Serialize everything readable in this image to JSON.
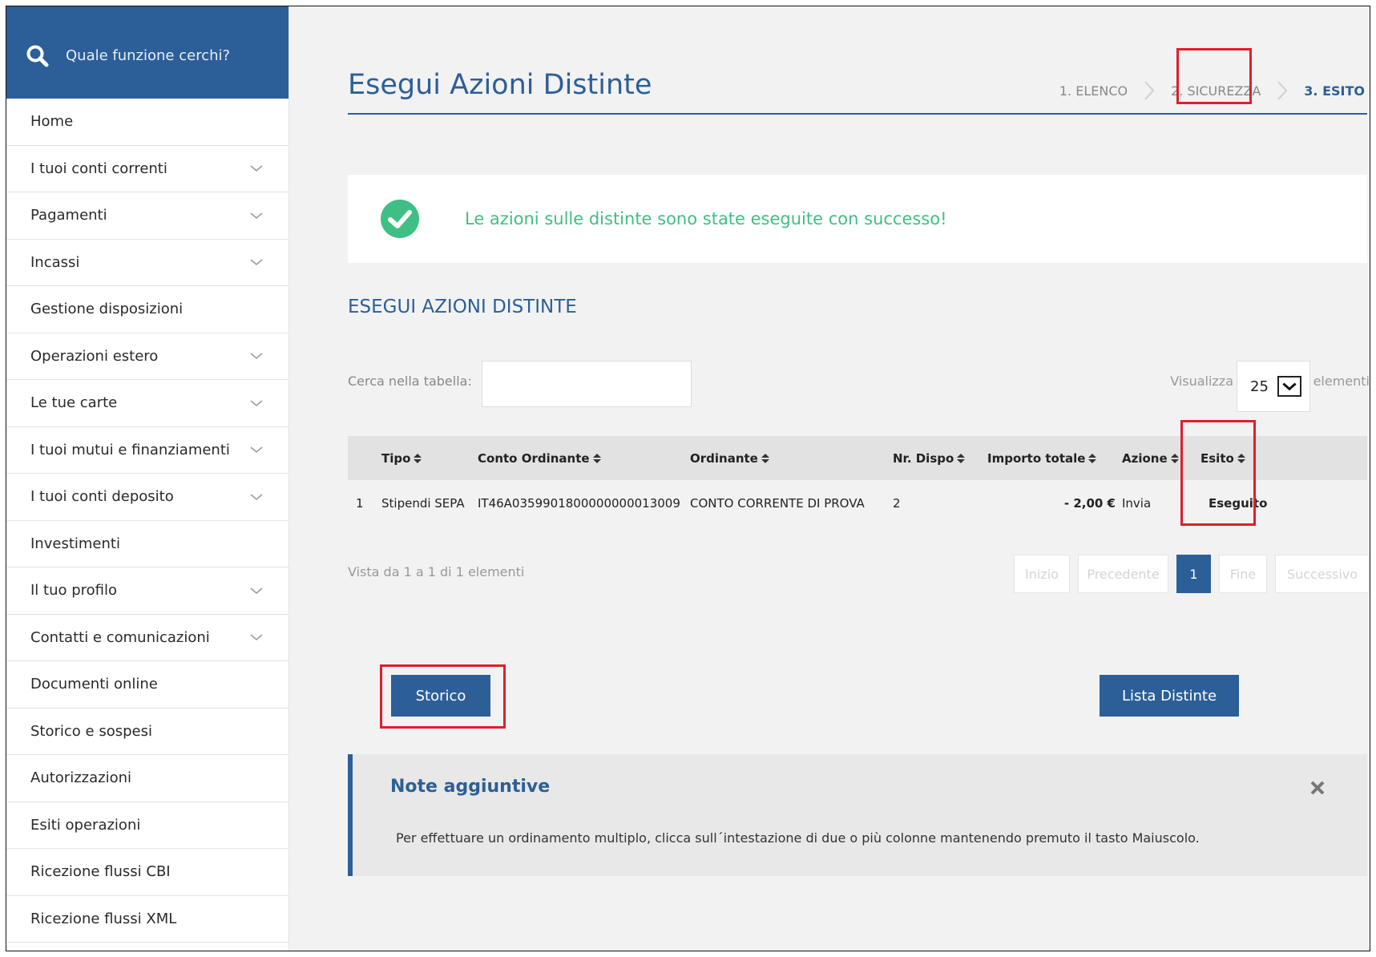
{
  "search": {
    "placeholder": "Quale funzione cerchi?"
  },
  "sidebar": {
    "items": [
      {
        "label": "Home",
        "expandable": false
      },
      {
        "label": "I tuoi conti correnti",
        "expandable": true
      },
      {
        "label": "Pagamenti",
        "expandable": true
      },
      {
        "label": "Incassi",
        "expandable": true
      },
      {
        "label": "Gestione disposizioni",
        "expandable": false
      },
      {
        "label": "Operazioni estero",
        "expandable": true
      },
      {
        "label": "Le tue carte",
        "expandable": true
      },
      {
        "label": "I tuoi mutui e finanziamenti",
        "expandable": true
      },
      {
        "label": "I tuoi conti deposito",
        "expandable": true
      },
      {
        "label": "Investimenti",
        "expandable": false
      },
      {
        "label": "Il tuo profilo",
        "expandable": true
      },
      {
        "label": "Contatti e comunicazioni",
        "expandable": true
      },
      {
        "label": "Documenti online",
        "expandable": false
      },
      {
        "label": "Storico e sospesi",
        "expandable": false
      },
      {
        "label": "Autorizzazioni",
        "expandable": false
      },
      {
        "label": "Esiti operazioni",
        "expandable": false
      },
      {
        "label": "Ricezione flussi CBI",
        "expandable": false
      },
      {
        "label": "Ricezione flussi XML",
        "expandable": false
      }
    ]
  },
  "header": {
    "title": "Esegui Azioni Distinte",
    "steps": [
      "1. ELENCO",
      "2. SICUREZZA",
      "3. ESITO"
    ],
    "active_step": "3. ESITO"
  },
  "alert": {
    "message": "Le azioni sulle distinte sono state eseguite con successo!"
  },
  "section": {
    "title": "ESEGUI AZIONI DISTINTE"
  },
  "table_controls": {
    "search_label": "Cerca nella tabella:",
    "search_value": "",
    "show_label": "Visualizza",
    "page_size": "25",
    "elements_label": "elementi"
  },
  "table": {
    "columns": [
      "",
      "Tipo",
      "Conto Ordinante",
      "Ordinante",
      "Nr. Dispo",
      "Importo totale",
      "Azione",
      "Esito"
    ],
    "rows": [
      {
        "index": "1",
        "tipo": "Stipendi SEPA",
        "conto": "IT46A0359901800000000013009",
        "ordinante": "CONTO CORRENTE DI PROVA",
        "nr_dispo": "2",
        "importo": "- 2,00 €",
        "azione": "Invia",
        "esito": "Eseguito"
      }
    ],
    "summary": "Vista da 1 a 1 di 1 elementi"
  },
  "pagination": {
    "first": "Inizio",
    "prev": "Precedente",
    "current": "1",
    "last": "Fine",
    "next": "Successivo"
  },
  "actions": {
    "history": "Storico",
    "list": "Lista Distinte"
  },
  "note": {
    "title": "Note aggiuntive",
    "text": "Per effettuare un ordinamento multiplo, clicca sull´intestazione di due o più colonne mantenendo premuto il tasto Maiuscolo."
  },
  "colors": {
    "primary": "#2c5f98",
    "success": "#3fbf83",
    "negative": "#d9313c",
    "highlight": "#e01e2b"
  },
  "icons": [
    "search-icon",
    "chevron-down-icon",
    "chevron-right-icon",
    "check-circle-icon",
    "sort-icon",
    "close-icon"
  ]
}
